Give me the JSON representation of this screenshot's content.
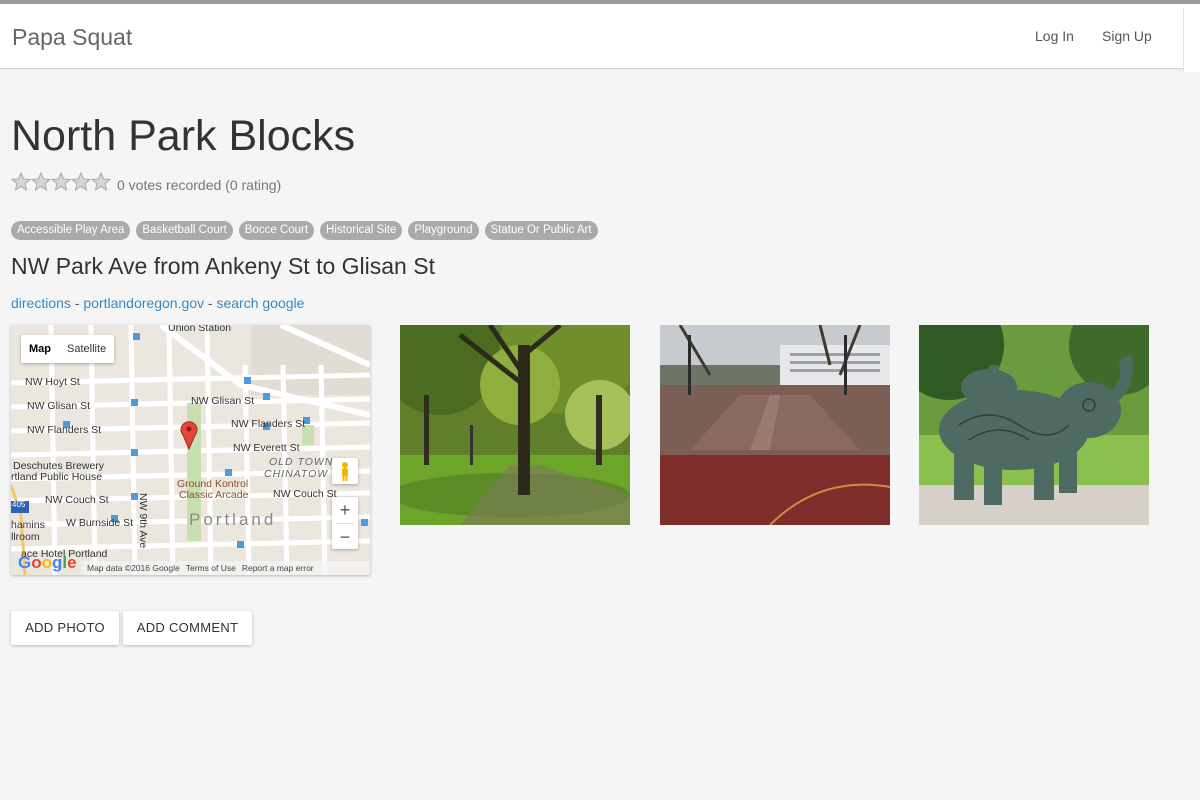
{
  "app": {
    "brand": "Papa Squat"
  },
  "nav": {
    "login": "Log In",
    "signup": "Sign Up"
  },
  "park": {
    "title": "North Park Blocks",
    "rating": {
      "stars_filled": 0,
      "stars_total": 5,
      "text": "0 votes recorded (0 rating)"
    },
    "tags": [
      "Accessible Play Area",
      "Basketball Court",
      "Bocce Court",
      "Historical Site",
      "Playground",
      "Statue Or Public Art"
    ],
    "address": "NW Park Ave from Ankeny St to Glisan St",
    "links": {
      "directions": "directions",
      "official": "portlandoregon.gov",
      "search": "search google",
      "separator": "-"
    }
  },
  "map": {
    "type_map": "Map",
    "type_satellite": "Satellite",
    "zoom_in": "+",
    "zoom_out": "−",
    "logo": "Google",
    "footer": {
      "data": "Map data ©2016 Google",
      "terms": "Terms of Use",
      "report": "Report a map error"
    },
    "labels": {
      "union_station": "Union Station",
      "hoyt": "NW Hoyt St",
      "glisan_w": "NW Glisan St",
      "glisan_e": "NW Glisan St",
      "flanders_w": "NW Flanders St",
      "flanders_e": "NW Flanders St",
      "everett": "NW Everett St",
      "old_town": "OLD TOWN",
      "chinatown": "CHINATOW",
      "deschutes": "Deschutes Brewery",
      "public_house": "rtland Public House",
      "ninth": "NW 9th Ave",
      "ground_kontrol": "Ground Kontrol",
      "classic_arcade": "Classic Arcade",
      "couch_w": "NW Couch St",
      "couch_e": "NW Couch St",
      "burnside": "W Burnside St",
      "portland": "Portland",
      "hamins": "hamins",
      "llroom": "llroom",
      "ace_hotel": "ace Hotel Portland",
      "i405": "405"
    }
  },
  "photos": [
    {
      "alt": "Tree-lined park path"
    },
    {
      "alt": "Basketball court in park"
    },
    {
      "alt": "Elephant statue"
    }
  ],
  "actions": {
    "add_photo": "ADD PHOTO",
    "add_comment": "ADD COMMENT"
  }
}
